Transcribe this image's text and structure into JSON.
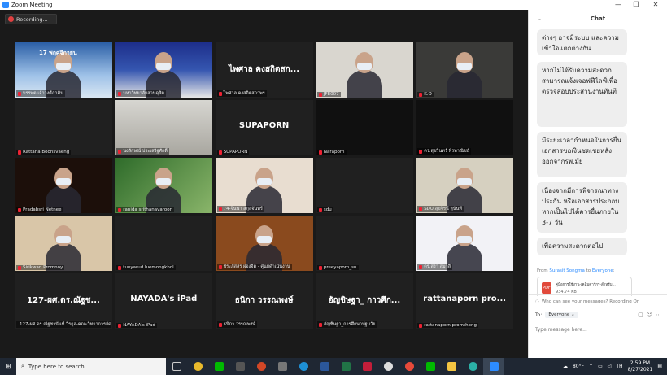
{
  "window": {
    "title": "Zoom Meeting",
    "minimize": "—",
    "maximize": "❐",
    "close": "✕"
  },
  "recording": {
    "label": "Recording..."
  },
  "participants": [
    {
      "name": "บรรพต เจ้าวงศ์ภาคิน",
      "video": "v1",
      "active": true,
      "overlay": "17 พฤศจิกายน"
    },
    {
      "name": "มหาวิทยาลัยสวนดุสิต",
      "video": "v2"
    },
    {
      "name": "ไพศาล คงสถิตสถาพร",
      "big": "ไพศาล คงสถิตสก..."
    },
    {
      "name": "JFE007",
      "video": "v3"
    },
    {
      "name": "K.O",
      "video": "v4"
    },
    {
      "name": "Rattana Boonsvaeng"
    },
    {
      "name": "นงลักษณ์ ประเสริฐศักดิ์",
      "video": "v5"
    },
    {
      "name": "SUPAPORN",
      "big": "SUPAPORN"
    },
    {
      "name": "Naraporn",
      "video": "v6"
    },
    {
      "name": "ดร.สุชรินทร์ พีรพาณิชย์",
      "video": "v6"
    },
    {
      "name": "Pradabsri Netnee",
      "video": "v7"
    },
    {
      "name": "ranida srithanavaroon",
      "video": "v8"
    },
    {
      "name": "74-จินนา สกุลจันทร์",
      "video": "v9"
    },
    {
      "name": "sdu"
    },
    {
      "name": "SDU.สุขจิรน์ สุนันท์",
      "video": "v10"
    },
    {
      "name": "Sirikwan Promnoy",
      "video": "v11"
    },
    {
      "name": "tunyarud luemongkhol"
    },
    {
      "name": "ประภัสสร ผ่องจิต - ศูนย์ดำเนินงาน",
      "video": "v12"
    },
    {
      "name": "preeyaporn_su"
    },
    {
      "name": "ดร.สรา สุมาลี",
      "video": "v13"
    },
    {
      "name": "127-ผศ.ดร.ณัฐชานันท์ วีรกุล-คณะวิทยาการจัดการ",
      "big": "127-ผศ.ดร.ณัฐช..."
    },
    {
      "name": "NAYADA's iPad",
      "big": "NAYADA's iPad"
    },
    {
      "name": "ธนิกา วรรณพงษ์",
      "big": "ธนิกา วรรณพงษ์"
    },
    {
      "name": "อัญชิษฐา_การศึกษาปฐมวัย",
      "big": "อัญชิษฐา_ กาวศึก..."
    },
    {
      "name": "rattanaporn promthong",
      "big": "rattanaporn pro..."
    }
  ],
  "chat": {
    "title": "Chat",
    "messages": [
      "ต่างๆ อาจมีระบบ และความเข้าใจแตกต่างกัน",
      "หากไม่ได้รับความสะดวกสามารถแจ้งเจอฟฟีไลฟ์เพื่อตรวจสอบประสานงานทันที",
      "มีระยะเวลากำหนดในการยื่นเอกสารขอเงินชดเชยหลังออกจากรพ.มัย",
      "เนื่องจากมีการพิจารณาทางประกัน หรือเอกสารประกอบหากเป็นไปได้ควรยื่นภายใน 3-7 วัน",
      "เพื่อความสะดวกต่อไป"
    ],
    "from_prefix": "From",
    "from_name": "Surasit Songma",
    "to_word": "to",
    "to_name": "Everyone",
    "from_suffix": ":",
    "file_name": "คู่มือการใช้งาน-เคลิมคาร์กร-สำหรับ...",
    "file_size": "934.74 KB",
    "who_can_see": "Who can see your messages? Recording On",
    "to_label": "To:",
    "to_value": "Everyone",
    "input_placeholder": "Type message here..."
  },
  "taskbar": {
    "search_placeholder": "Type here to search",
    "weather": "80°F",
    "lang": "TH",
    "time": "2:59 PM",
    "date": "8/27/2021"
  }
}
